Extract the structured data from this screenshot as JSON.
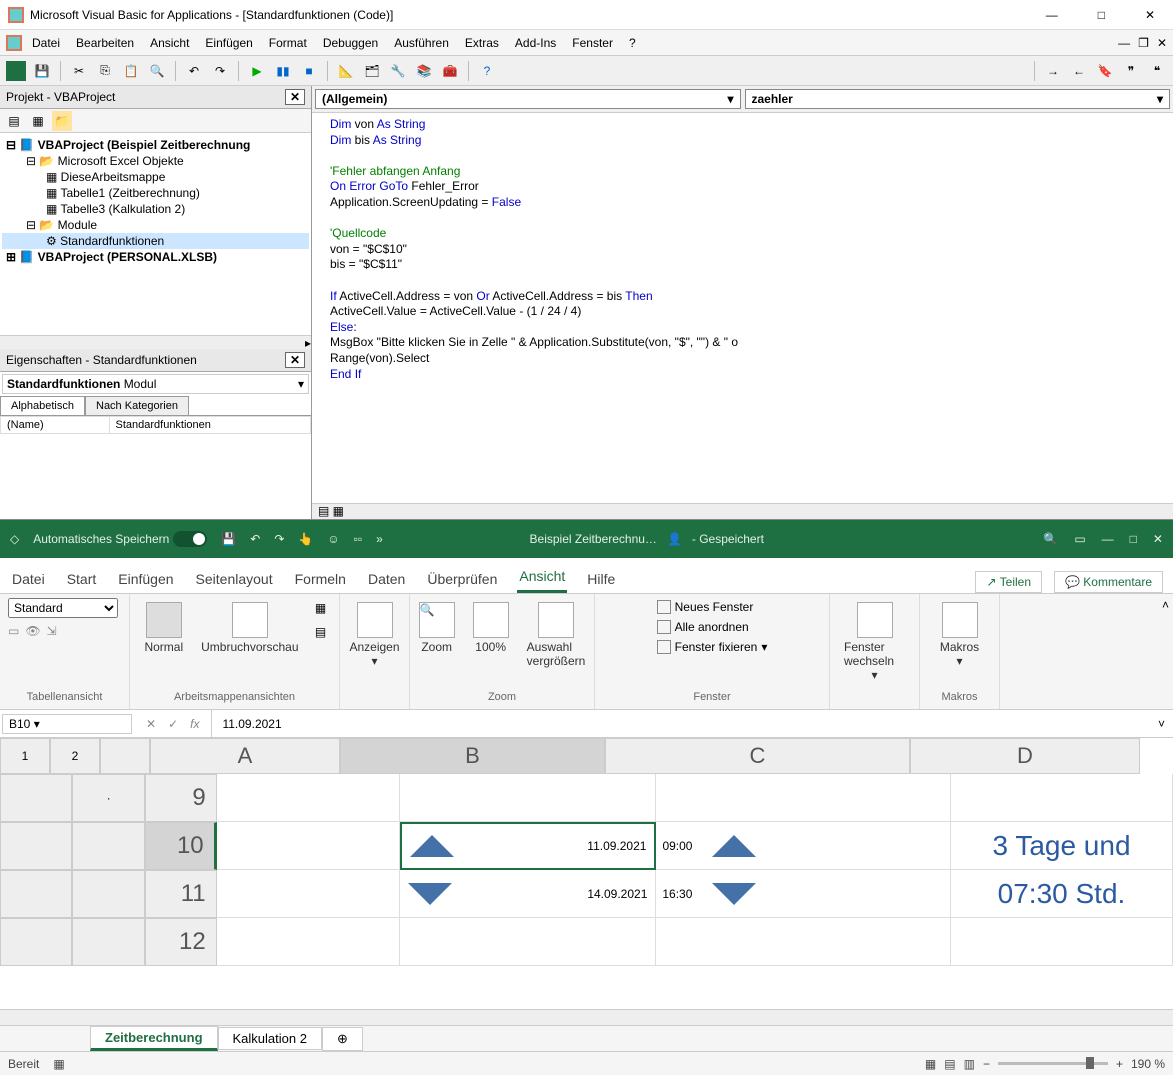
{
  "vba": {
    "title": "Microsoft Visual Basic for Applications - [Standardfunktionen (Code)]",
    "menus": [
      "Datei",
      "Bearbeiten",
      "Ansicht",
      "Einfügen",
      "Format",
      "Debuggen",
      "Ausführen",
      "Extras",
      "Add-Ins",
      "Fenster",
      "?"
    ],
    "project_pane_title": "Projekt - VBAProject",
    "tree": {
      "root1": "VBAProject (Beispiel Zeitberechnung",
      "excel_obj": "Microsoft Excel Objekte",
      "wb": "DieseArbeitsmappe",
      "sh1": "Tabelle1 (Zeitberechnung)",
      "sh2": "Tabelle3 (Kalkulation 2)",
      "modfold": "Module",
      "mod1": "Standardfunktionen",
      "root2": "VBAProject (PERSONAL.XLSB)"
    },
    "props_pane_title": "Eigenschaften - Standardfunktionen",
    "props_object": "Standardfunktionen",
    "props_type": "Modul",
    "props_tabs": [
      "Alphabetisch",
      "Nach Kategorien"
    ],
    "props_name_label": "(Name)",
    "props_name_value": "Standardfunktionen",
    "combo_left": "(Allgemein)",
    "combo_right": "zaehler",
    "code_lines": [
      {
        "t": "Dim von As String"
      },
      {
        "t": "Dim bis As String"
      },
      {
        "t": ""
      },
      {
        "t": "'Fehler abfangen Anfang",
        "cls": "cm"
      },
      {
        "t": "On Error GoTo Fehler_Error"
      },
      {
        "t": "Application.ScreenUpdating = False"
      },
      {
        "t": ""
      },
      {
        "t": "'Quellcode",
        "cls": "cm"
      },
      {
        "t": "von = \"$C$10\""
      },
      {
        "t": "bis = \"$C$11\""
      },
      {
        "t": ""
      },
      {
        "t": "If ActiveCell.Address = von Or ActiveCell.Address = bis Then"
      },
      {
        "t": "ActiveCell.Value = ActiveCell.Value - (1 / 24 / 4)"
      },
      {
        "t": "Else:"
      },
      {
        "t": "MsgBox \"Bitte klicken Sie in Zelle \" & Application.Substitute(von, \"$\", \"\") & \" o"
      },
      {
        "t": "Range(von).Select"
      },
      {
        "t": "End If"
      }
    ]
  },
  "excel": {
    "autosave_label": "Automatisches Speichern",
    "doc_title": "Beispiel Zeitberechnu…",
    "saved_status": "-  Gespeichert",
    "tabs": [
      "Datei",
      "Start",
      "Einfügen",
      "Seitenlayout",
      "Formeln",
      "Daten",
      "Überprüfen",
      "Ansicht",
      "Hilfe"
    ],
    "active_tab": "Ansicht",
    "share": "Teilen",
    "comments": "Kommentare",
    "ribbon": {
      "views_select": "Standard",
      "normal": "Normal",
      "pagebreak": "Umbruchvorschau",
      "anzeigen": "Anzeigen",
      "zoom": "Zoom",
      "z100": "100%",
      "zsel": "Auswahl vergrößern",
      "newwin": "Neues Fenster",
      "arrange": "Alle anordnen",
      "freeze": "Fenster fixieren",
      "switch": "Fenster wechseln",
      "macros": "Makros",
      "g_table": "Tabellenansicht",
      "g_wb": "Arbeitsmappenansichten",
      "g_zoom": "Zoom",
      "g_win": "Fenster",
      "g_macros": "Makros"
    },
    "namebox": "B10",
    "formula": "11.09.2021",
    "cols": [
      "A",
      "B",
      "C",
      "D"
    ],
    "rows": [
      "9",
      "10",
      "11",
      "12"
    ],
    "b10": "11.09.2021",
    "c10": "09:00",
    "b11": "14.09.2021",
    "c11": "16:30",
    "d_result1": "3 Tage und",
    "d_result2": "07:30 Std.",
    "sheet_tabs": [
      "Zeitberechnung",
      "Kalkulation 2"
    ],
    "status": "Bereit",
    "zoom": "190 %"
  }
}
